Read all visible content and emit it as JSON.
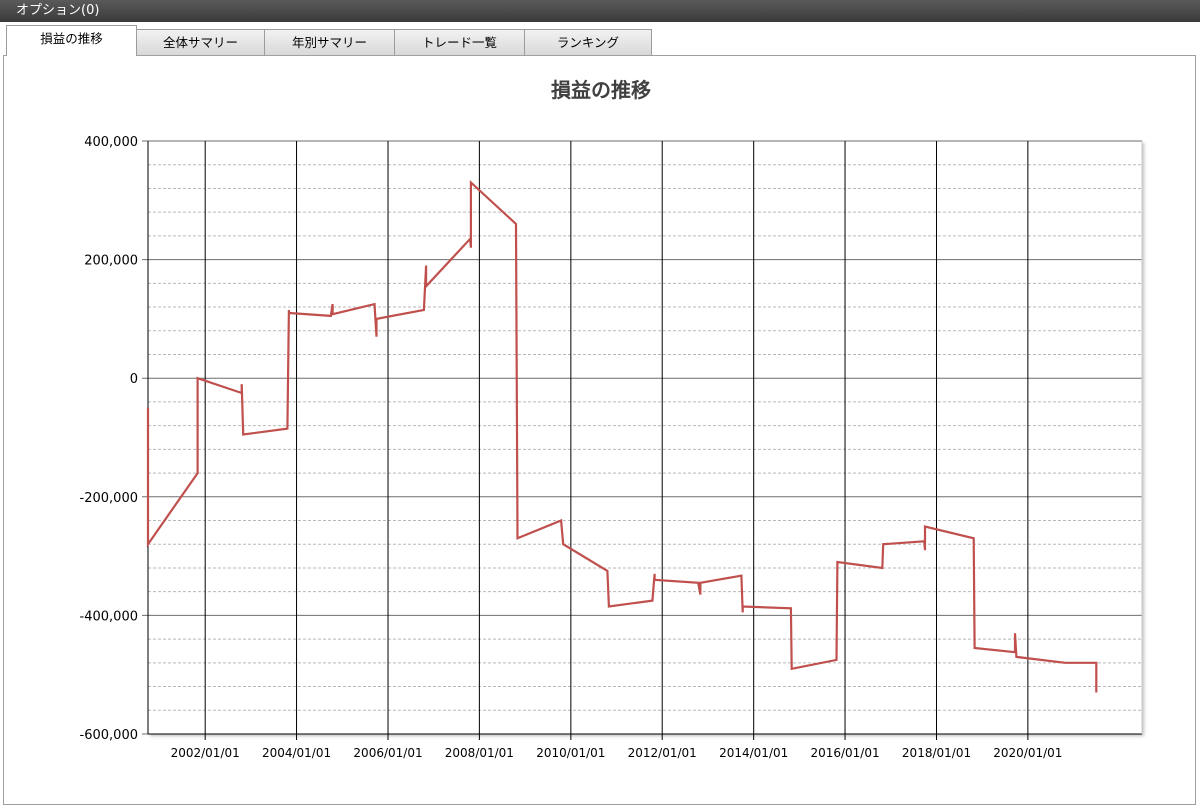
{
  "window": {
    "title": "オプション(0)"
  },
  "tabs": [
    {
      "label": "損益の推移",
      "active": true
    },
    {
      "label": "全体サマリー",
      "active": false
    },
    {
      "label": "年別サマリー",
      "active": false
    },
    {
      "label": "トレード一覧",
      "active": false
    },
    {
      "label": "ランキング",
      "active": false
    }
  ],
  "chart_data": {
    "type": "line",
    "title": "損益の推移",
    "xlabel": "",
    "ylabel": "",
    "ylim": [
      -600000,
      400000
    ],
    "xlim": [
      "2000-10-01",
      "2022-07-01"
    ],
    "yticks": [
      400000,
      200000,
      0,
      -200000,
      -400000,
      -600000
    ],
    "ytick_labels": [
      "400,000",
      "200,000",
      "0",
      "-200,000",
      "-400,000",
      "-600,000"
    ],
    "xticks": [
      "2002-01-01",
      "2004-01-01",
      "2006-01-01",
      "2008-01-01",
      "2010-01-01",
      "2012-01-01",
      "2014-01-01",
      "2016-01-01",
      "2018-01-01",
      "2020-01-01"
    ],
    "xtick_labels": [
      "2002/01/01",
      "2004/01/01",
      "2006/01/01",
      "2008/01/01",
      "2010/01/01",
      "2012/01/01",
      "2014/01/01",
      "2016/01/01",
      "2018/01/01",
      "2020/01/01"
    ],
    "grid": true,
    "line_color": "#c0504d",
    "series": [
      {
        "points": [
          [
            "2000-10-01",
            -50000
          ],
          [
            "2000-10-01",
            -280000
          ],
          [
            "2001-11-01",
            -160000
          ],
          [
            "2001-11-01",
            0
          ],
          [
            "2002-10-20",
            -25000
          ],
          [
            "2002-10-20",
            -10000
          ],
          [
            "2002-11-01",
            -95000
          ],
          [
            "2003-10-20",
            -85000
          ],
          [
            "2003-11-01",
            115000
          ],
          [
            "2003-11-02",
            110000
          ],
          [
            "2004-10-01",
            105000
          ],
          [
            "2004-10-15",
            125000
          ],
          [
            "2004-10-15",
            108000
          ],
          [
            "2005-09-15",
            125000
          ],
          [
            "2005-10-01",
            70000
          ],
          [
            "2005-10-01",
            100000
          ],
          [
            "2006-10-15",
            115000
          ],
          [
            "2006-11-01",
            190000
          ],
          [
            "2006-11-01",
            155000
          ],
          [
            "2007-10-20",
            235000
          ],
          [
            "2007-10-25",
            220000
          ],
          [
            "2007-10-25",
            330000
          ],
          [
            "2008-10-20",
            260000
          ],
          [
            "2008-11-01",
            -270000
          ],
          [
            "2009-10-15",
            -240000
          ],
          [
            "2009-11-01",
            -280000
          ],
          [
            "2010-10-20",
            -325000
          ],
          [
            "2010-11-01",
            -385000
          ],
          [
            "2011-10-15",
            -375000
          ],
          [
            "2011-11-01",
            -330000
          ],
          [
            "2011-11-01",
            -340000
          ],
          [
            "2012-10-15",
            -345000
          ],
          [
            "2012-11-01",
            -365000
          ],
          [
            "2012-11-01",
            -345000
          ],
          [
            "2013-09-25",
            -333000
          ],
          [
            "2013-10-05",
            -395000
          ],
          [
            "2013-10-05",
            -385000
          ],
          [
            "2014-10-25",
            -388000
          ],
          [
            "2014-11-01",
            -490000
          ],
          [
            "2015-10-25",
            -475000
          ],
          [
            "2015-11-01",
            -310000
          ],
          [
            "2016-10-25",
            -320000
          ],
          [
            "2016-11-01",
            -280000
          ],
          [
            "2017-09-25",
            -275000
          ],
          [
            "2017-10-01",
            -290000
          ],
          [
            "2017-10-01",
            -250000
          ],
          [
            "2018-10-25",
            -270000
          ],
          [
            "2018-11-01",
            -455000
          ],
          [
            "2019-09-20",
            -462000
          ],
          [
            "2019-09-20",
            -430000
          ],
          [
            "2019-10-01",
            -470000
          ],
          [
            "2020-10-25",
            -480000
          ],
          [
            "2021-07-01",
            -480000
          ],
          [
            "2021-07-01",
            -530000
          ]
        ]
      }
    ]
  }
}
